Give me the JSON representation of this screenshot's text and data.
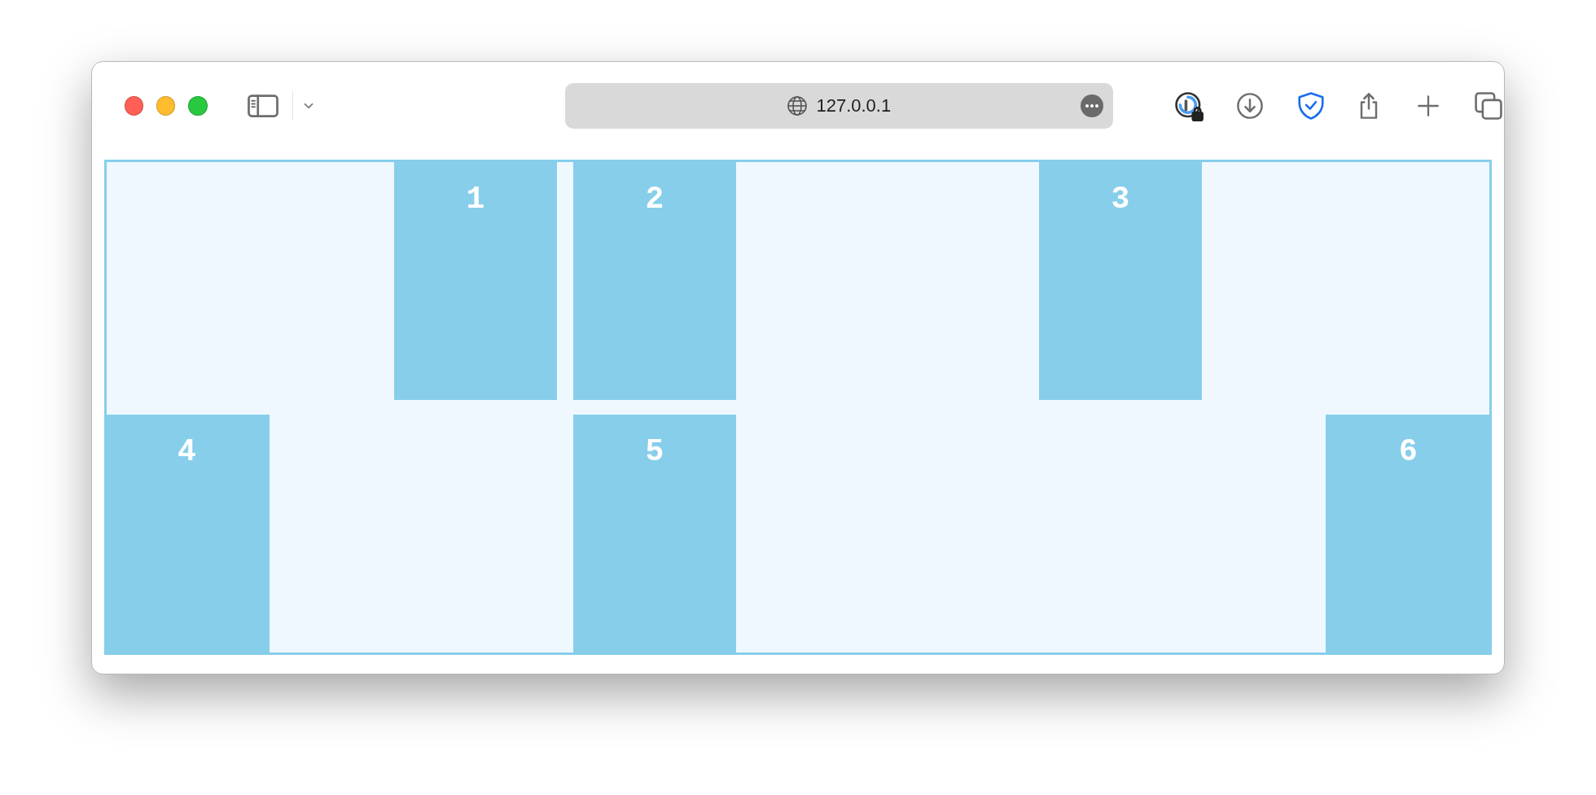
{
  "address_bar": {
    "url": "127.0.0.1"
  },
  "flex_container": {
    "rows": [
      {
        "items": [
          {
            "label": "1"
          },
          {
            "label": "2"
          },
          {
            "label": "3"
          }
        ]
      },
      {
        "items": [
          {
            "label": "4"
          },
          {
            "label": "5"
          },
          {
            "label": "6"
          }
        ]
      }
    ]
  }
}
